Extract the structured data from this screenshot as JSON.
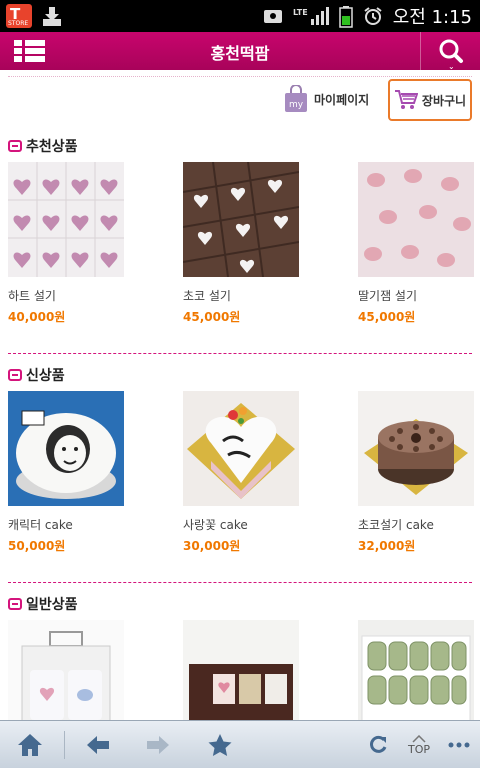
{
  "status_bar": {
    "time": "오전 1:15",
    "network": "LTE",
    "icons": [
      "tstore-icon",
      "download-icon",
      "screenshot-icon",
      "signal-icon",
      "battery-icon",
      "alarm-icon"
    ],
    "tstore_label": "T",
    "tstore_sub": "STORE"
  },
  "header": {
    "title": "홍천떡팜",
    "accent_color": "#c8056d",
    "chevron": "⌄"
  },
  "top_actions": {
    "mypage_label": "마이페이지",
    "mypage_badge": "my",
    "cart_label": "장바구니"
  },
  "sections": [
    {
      "title": "추천상품",
      "products": [
        {
          "name": "하트 설기",
          "price": "40,000원"
        },
        {
          "name": "초코 설기",
          "price": "45,000원"
        },
        {
          "name": "딸기잼 설기",
          "price": "45,000원"
        }
      ]
    },
    {
      "title": "신상품",
      "products": [
        {
          "name": "캐릭터 cake",
          "price": "50,000원"
        },
        {
          "name": "사랑꽃 cake",
          "price": "30,000원"
        },
        {
          "name": "초코설기 cake",
          "price": "32,000원"
        }
      ]
    },
    {
      "title": "일반상품",
      "products": [
        {
          "name": "",
          "price": ""
        },
        {
          "name": "",
          "price": ""
        },
        {
          "name": "",
          "price": ""
        }
      ]
    }
  ],
  "toolbar": {
    "items": [
      "home-icon",
      "back-icon",
      "forward-icon",
      "bookmark-star-icon",
      "refresh-icon",
      "top-button",
      "more-icon"
    ],
    "top_label": "TOP"
  },
  "colors": {
    "price": "#f07800",
    "section_accent": "#d4147c",
    "cart_highlight": "#ea7a2a"
  }
}
